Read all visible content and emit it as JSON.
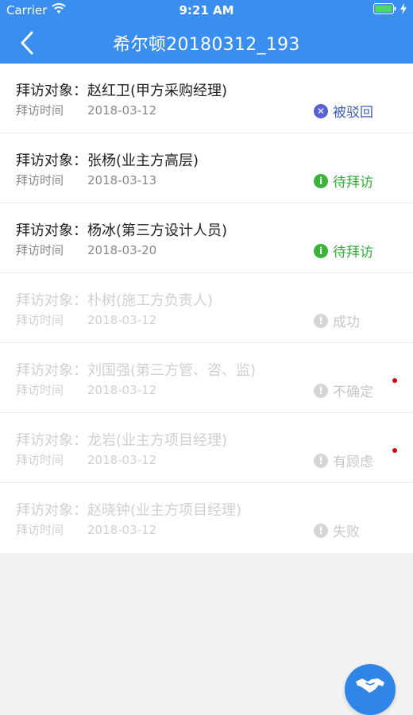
{
  "status_bar": {
    "carrier": "Carrier",
    "time": "9:21 AM"
  },
  "nav": {
    "title": "希尔顿20180312_193"
  },
  "labels": {
    "visit_target_prefix": "拜访对象：",
    "visit_time_label": "拜访时间"
  },
  "visits": [
    {
      "target": "赵红卫(甲方采购经理)",
      "date": "2018-03-12",
      "status": "被驳回",
      "status_icon": "x-circle-icon",
      "status_color": "#5b5fd6",
      "text_color": "#3b5fb8",
      "faded": false,
      "unread": false
    },
    {
      "target": "张杨(业主方高层)",
      "date": "2018-03-13",
      "status": "待拜访",
      "status_icon": "info-circle-icon",
      "status_color": "#3cb43c",
      "text_color": "#3aa83a",
      "faded": false,
      "unread": false
    },
    {
      "target": "杨冰(第三方设计人员)",
      "date": "2018-03-20",
      "status": "待拜访",
      "status_icon": "info-circle-icon",
      "status_color": "#3cb43c",
      "text_color": "#3aa83a",
      "faded": false,
      "unread": false
    },
    {
      "target": "朴树(施工方负责人)",
      "date": "2018-03-12",
      "status": "成功",
      "status_icon": "alert-circle-icon",
      "status_color": "#d6d6d6",
      "text_color": "#c8c8c8",
      "faded": true,
      "unread": false
    },
    {
      "target": "刘国强(第三方管、咨、监)",
      "date": "2018-03-12",
      "status": "不确定",
      "status_icon": "alert-circle-icon",
      "status_color": "#d6d6d6",
      "text_color": "#c8c8c8",
      "faded": true,
      "unread": true
    },
    {
      "target": "龙岩(业主方项目经理)",
      "date": "2018-03-12",
      "status": "有顾虑",
      "status_icon": "alert-circle-icon",
      "status_color": "#d6d6d6",
      "text_color": "#c8c8c8",
      "faded": true,
      "unread": true
    },
    {
      "target": "赵晓钟(业主方项目经理)",
      "date": "2018-03-12",
      "status": "失败",
      "status_icon": "alert-circle-icon",
      "status_color": "#d6d6d6",
      "text_color": "#c8c8c8",
      "faded": true,
      "unread": false
    }
  ],
  "colors": {
    "header": "#3a8ef0",
    "fab": "#2f86e8",
    "unread_dot": "#d0021b"
  },
  "fab": {
    "icon": "handshake-icon"
  }
}
